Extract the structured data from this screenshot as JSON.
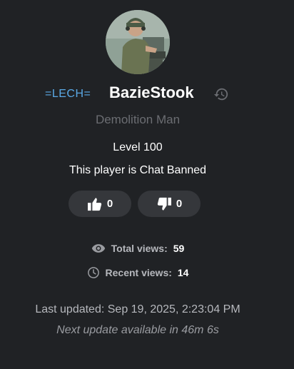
{
  "profile": {
    "clan_tag": "=LECH=",
    "player_name": "BazieStook",
    "title": "Demolition Man",
    "level": "Level 100",
    "ban_status": "This player is Chat Banned",
    "avatar_icon": "soldier-avatar"
  },
  "votes": {
    "likes": "0",
    "dislikes": "0",
    "like_icon": "thumbs-up-icon",
    "dislike_icon": "thumbs-down-icon"
  },
  "stats": {
    "total_views_label": "Total views:",
    "total_views_value": "59",
    "recent_views_label": "Recent views:",
    "recent_views_value": "14"
  },
  "update": {
    "last_updated": "Last updated: Sep 19, 2025, 2:23:04 PM",
    "next_update": "Next update available in 46m 6s"
  },
  "colors": {
    "background": "#202225",
    "clan_tag": "#5aa9e6",
    "button_bg": "#35373b",
    "muted_text": "#6b6d72"
  }
}
